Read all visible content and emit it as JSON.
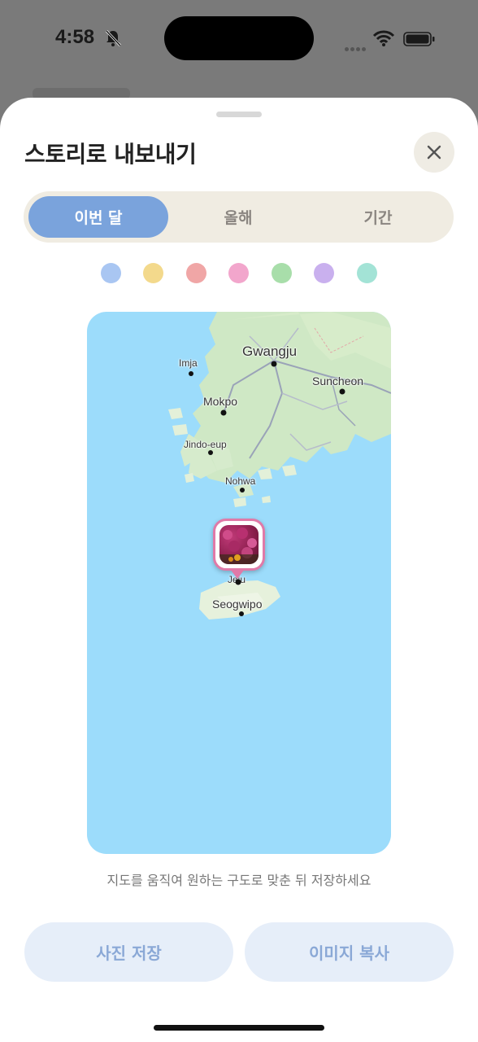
{
  "status_bar": {
    "time": "4:58",
    "icons": [
      "bell-slash-icon",
      "cellular-dots-icon",
      "wifi-icon",
      "battery-icon"
    ]
  },
  "sheet": {
    "title": "스토리로 내보내기",
    "close_icon": "close-icon",
    "segments": [
      {
        "label": "이번 달",
        "selected": true
      },
      {
        "label": "올해",
        "selected": false
      },
      {
        "label": "기간",
        "selected": false
      }
    ],
    "color_swatches": [
      "#a9c6f2",
      "#f3d98c",
      "#f0a6a6",
      "#f2a6cc",
      "#a8deaa",
      "#c9b0ee",
      "#a3e3d6"
    ],
    "map": {
      "labels": {
        "gwangju": "Gwangju",
        "imja": "Imja",
        "suncheon": "Suncheon",
        "mokpo": "Mokpo",
        "jindo": "Jindo-eup",
        "nohwa": "Nohwa",
        "seogwipo": "Seogwipo",
        "jeju": "Jeju"
      },
      "pin_icon": "photo-pin-icon"
    },
    "hint": "지도를 움직여 원하는 구도로 맞춘 뒤 저장하세요",
    "buttons": {
      "save_photo": "사진 저장",
      "copy_image": "이미지 복사"
    }
  }
}
